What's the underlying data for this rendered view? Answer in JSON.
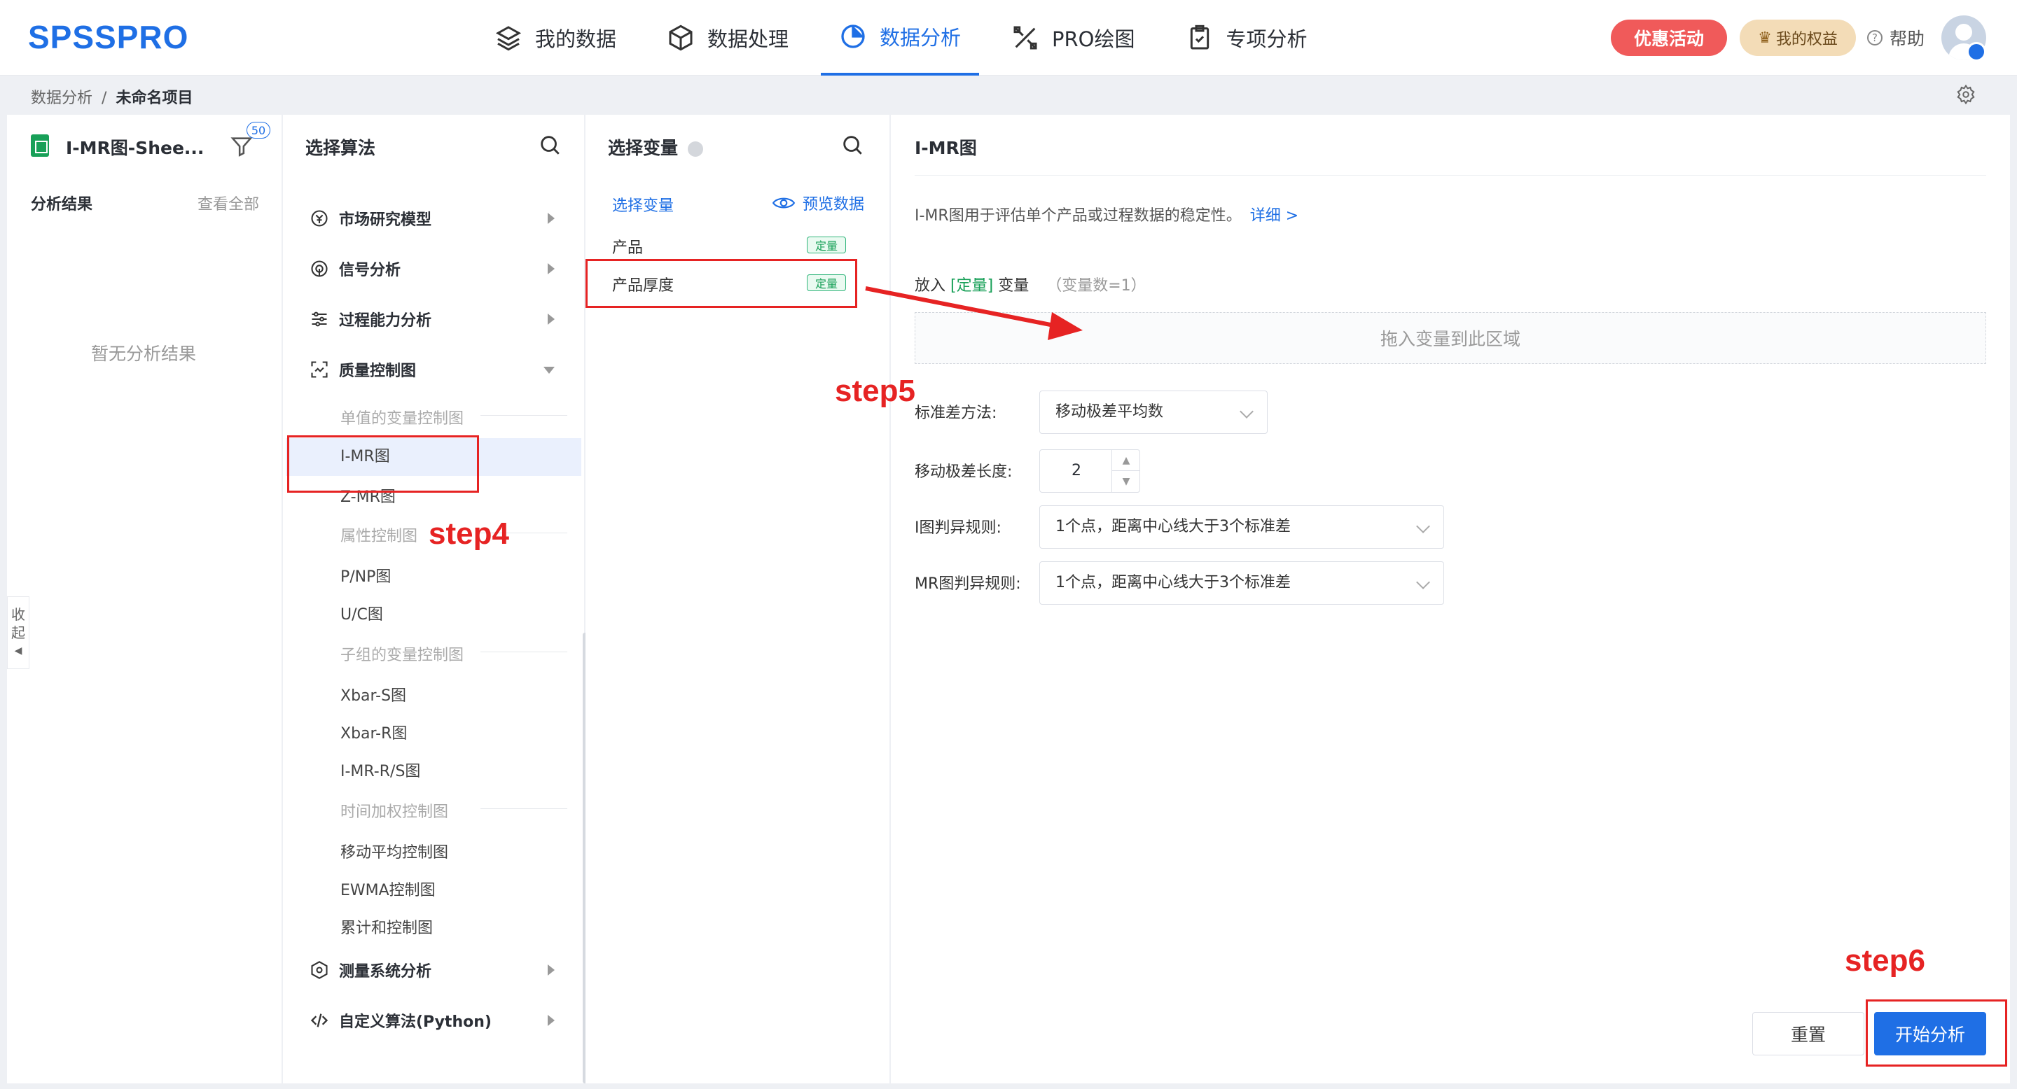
{
  "app": {
    "logo": "SPSSPRO"
  },
  "nav": [
    {
      "label": "我的数据",
      "icon": "layers-icon"
    },
    {
      "label": "数据处理",
      "icon": "cube-icon"
    },
    {
      "label": "数据分析",
      "icon": "pie-chart-icon",
      "active": true
    },
    {
      "label": "PRO绘图",
      "icon": "draw-icon"
    },
    {
      "label": "专项分析",
      "icon": "clipboard-icon"
    }
  ],
  "header": {
    "promo": "优惠活动",
    "rights": "我的权益",
    "help": "帮助"
  },
  "breadcrumb": {
    "parent": "数据分析",
    "sep": "/",
    "current": "未命名项目"
  },
  "left_panel": {
    "sheet_name": "I-MR图-Shee...",
    "filter_badge": "50",
    "results_title": "分析结果",
    "view_all": "查看全部",
    "empty": "暂无分析结果",
    "collapse": [
      "收",
      "起"
    ]
  },
  "algo_panel": {
    "title": "选择算法",
    "categories": [
      {
        "label": "市场研究模型",
        "icon": "currency-icon"
      },
      {
        "label": "信号分析",
        "icon": "signal-icon"
      },
      {
        "label": "过程能力分析",
        "icon": "sliders-icon"
      },
      {
        "label": "质量控制图",
        "icon": "scan-icon",
        "expanded": true
      },
      {
        "label": "测量系统分析",
        "icon": "hexagon-icon"
      },
      {
        "label": "自定义算法(Python)",
        "icon": "code-icon"
      }
    ],
    "groups": [
      "单值的变量控制图",
      "属性控制图",
      "子组的变量控制图",
      "时间加权控制图"
    ],
    "items": [
      "I-MR图",
      "Z-MR图",
      "P/NP图",
      "U/C图",
      "Xbar-S图",
      "Xbar-R图",
      "I-MR-R/S图",
      "移动平均控制图",
      "EWMA控制图",
      "累计和控制图"
    ],
    "selected": "I-MR图"
  },
  "var_panel": {
    "title": "选择变量",
    "head": "选择变量",
    "preview": "预览数据",
    "variables": [
      {
        "name": "产品",
        "tag": "定量"
      },
      {
        "name": "产品厚度",
        "tag": "定量"
      }
    ]
  },
  "config": {
    "title": "I-MR图",
    "desc": "I-MR图用于评估单个产品或过程数据的稳定性。",
    "detail_link": "详细 >",
    "put_prefix": "放入",
    "put_type": "[定量]",
    "put_suffix": "变量",
    "var_count": "（变量数=1）",
    "dropzone": "拖入变量到此区域",
    "std_label": "标准差方法:",
    "std_value": "移动极差平均数",
    "mr_len_label": "移动极差长度:",
    "mr_len_value": "2",
    "i_rule_label": "I图判异规则:",
    "i_rule_value": "1个点，距离中心线大于3个标准差",
    "mr_rule_label": "MR图判异规则:",
    "mr_rule_value": "1个点，距离中心线大于3个标准差",
    "reset": "重置",
    "start": "开始分析"
  },
  "annotations": {
    "step4": "step4",
    "step5": "step5",
    "step6": "step6",
    "color": "#e62323"
  },
  "colors": {
    "accent": "#1f6fe5",
    "promo": "#f05a5a",
    "tag_green": "#18a058"
  }
}
